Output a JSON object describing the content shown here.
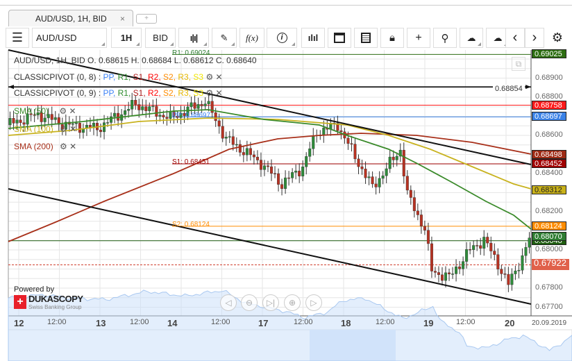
{
  "tab": {
    "title": "AUD/USD, 1H, BID",
    "close": "×",
    "new": "+"
  },
  "toolbar": {
    "menu": "☰",
    "instrument": "AUD/USD",
    "period": "1H",
    "side": "BID",
    "fx": "f(x)",
    "info": "i",
    "prev": "‹",
    "next": "›"
  },
  "legend": {
    "ohlc": "AUD/USD, 1H, BID   O. 0.68615 H. 0.68684 L. 0.68612 C. 0.68640",
    "pivot1": "CLASSICPIVOT (0, 8)",
    "pivot2": "CLASSICPIVOT (0, 9)",
    "pivot_items": [
      {
        "t": "PP",
        "c": "#3b82f6"
      },
      {
        "t": "R1",
        "c": "#2e8b2e"
      },
      {
        "t": "S1",
        "c": "#b22222"
      },
      {
        "t": "R2",
        "c": "#ff0000"
      },
      {
        "t": "S2",
        "c": "#ff8c00"
      },
      {
        "t": "R3",
        "c": "#e6b800"
      },
      {
        "t": "S3",
        "c": "#f2e600"
      }
    ],
    "sma50": "SMA (50)",
    "sma100": "SMA (100)",
    "sma200": "SMA (200)"
  },
  "levels": {
    "r1": "R1: 0.69024",
    "pp": "PP: 0.68697",
    "s1": "S1: 0.68451",
    "s2": "S2: 0.68124",
    "hline": "0.68854"
  },
  "badges": [
    {
      "v": "0.69025",
      "c": "#2e6e12",
      "p": 0.69025
    },
    {
      "v": "0.68758",
      "c": "#ff1a1a",
      "p": 0.68758
    },
    {
      "v": "0.68697",
      "c": "#3b82e6",
      "p": 0.68697
    },
    {
      "v": "0.68498",
      "c": "#9e2a14",
      "p": 0.68498
    },
    {
      "v": "0.68452",
      "c": "#a00000",
      "p": 0.68452
    },
    {
      "v": "0.68312",
      "c": "#c9b21a",
      "p": 0.68312
    },
    {
      "v": "0.68124",
      "c": "#ff8c00",
      "p": 0.68124
    },
    {
      "v": "0.68048",
      "c": "#1f5e10",
      "p": 0.68048
    },
    {
      "v": "0.68070",
      "c": "#2e7d32",
      "p": 0.6807
    },
    {
      "v": "0.67922",
      "c": "#e0604a",
      "p": 0.67922
    }
  ],
  "price_axis": [
    "0.68900",
    "0.68800",
    "0.68600",
    "0.68400",
    "0.68200",
    "0.68000",
    "0.67800",
    "0.67700"
  ],
  "time_axis": [
    {
      "t": "12",
      "b": true
    },
    {
      "t": "12:00"
    },
    {
      "t": "13",
      "b": true
    },
    {
      "t": "12:00"
    },
    {
      "t": "14",
      "b": true
    },
    {
      "t": "12:00"
    },
    {
      "t": "17",
      "b": true
    },
    {
      "t": "12:00"
    },
    {
      "t": "18",
      "b": true
    },
    {
      "t": "12:00"
    },
    {
      "t": "19",
      "b": true
    },
    {
      "t": "12:00"
    },
    {
      "t": "20",
      "b": true
    },
    {
      "t": "20.09.2019"
    }
  ],
  "brand": {
    "powered": "Powered by",
    "name": "DUKASCOPY",
    "sub": "Swiss Banking Group"
  },
  "price_path": [
    [
      0,
      0.68655
    ],
    [
      9,
      0.6871
    ],
    [
      17,
      0.68655
    ],
    [
      26,
      0.68636
    ],
    [
      37,
      0.68764
    ],
    [
      47,
      0.6869
    ],
    [
      57,
      0.6878
    ],
    [
      63,
      0.68582
    ],
    [
      73,
      0.68455
    ],
    [
      79,
      0.68345
    ],
    [
      85,
      0.68436
    ],
    [
      89,
      0.68618
    ],
    [
      95,
      0.68655
    ],
    [
      101,
      0.68455
    ],
    [
      105,
      0.68327
    ],
    [
      113,
      0.68527
    ],
    [
      115,
      0.6829
    ],
    [
      120,
      0.6811
    ],
    [
      122,
      0.6789
    ],
    [
      127,
      0.67855
    ],
    [
      133,
      0.68
    ],
    [
      137,
      0.68055
    ],
    [
      141,
      0.67927
    ],
    [
      144,
      0.67818
    ],
    [
      148,
      0.67964
    ],
    [
      150,
      0.68055
    ]
  ],
  "colors": {
    "sma50": "#3a8a2a",
    "sma100": "#c8b21e",
    "sma200": "#a8301a"
  }
}
